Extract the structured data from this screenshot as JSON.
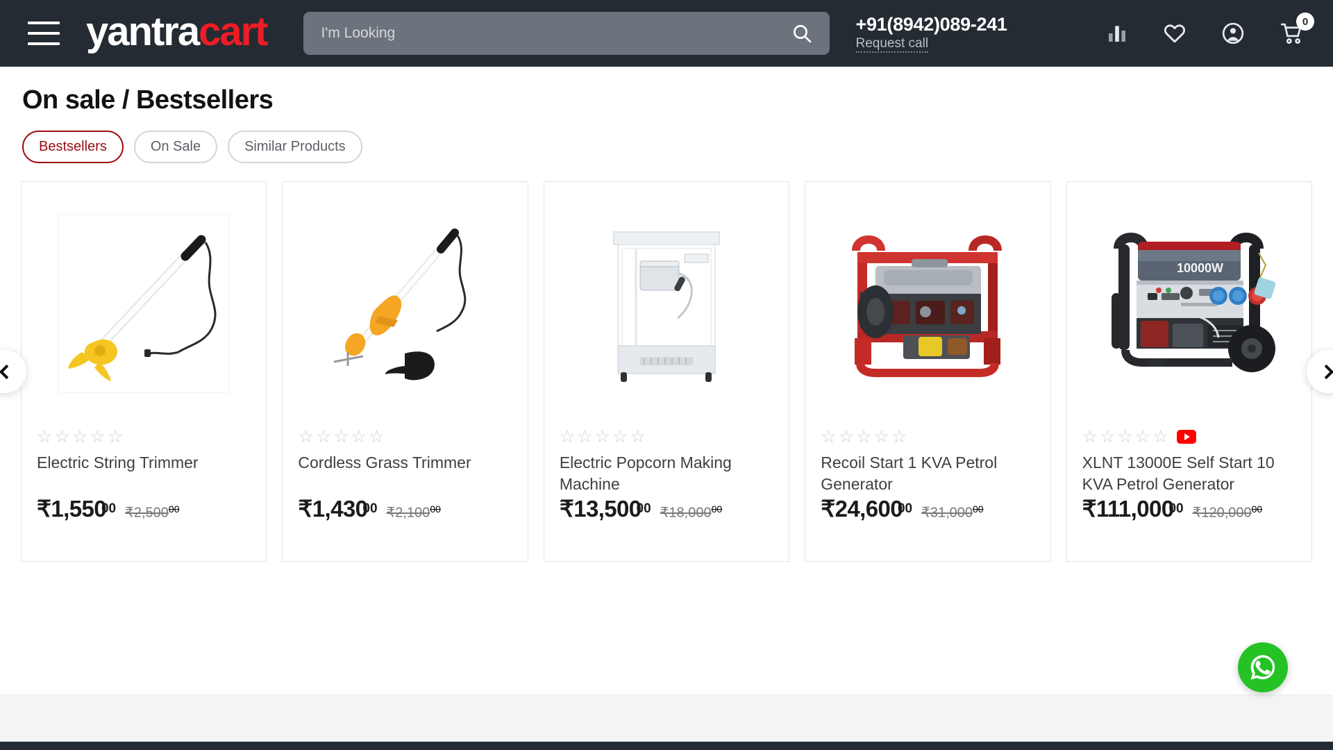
{
  "header": {
    "menu_label": "Menu",
    "logo": {
      "part1": "yantra",
      "part2": "cart",
      "part1_color": "#ffffff",
      "part2_color": "#ee1c25"
    },
    "search": {
      "placeholder": "I'm Looking",
      "value": "",
      "button_label": "Search"
    },
    "phone": "+91(8942)089-241",
    "request_call": "Request call",
    "icons": [
      {
        "name": "compare-icon",
        "label": "Compare"
      },
      {
        "name": "wishlist-icon",
        "label": "Wishlist"
      },
      {
        "name": "account-icon",
        "label": "Account"
      },
      {
        "name": "cart-icon",
        "label": "Cart"
      }
    ],
    "cart_count": "0",
    "background": "#252b33"
  },
  "main": {
    "title": "On sale / Bestsellers",
    "tabs": [
      {
        "label": "Bestsellers",
        "active": true
      },
      {
        "label": "On Sale",
        "active": false
      },
      {
        "label": "Similar Products",
        "active": false
      }
    ],
    "active_tab_color": "#9b0d13"
  },
  "carousel": {
    "prev_label": "Previous",
    "next_label": "Next",
    "rating_empty_star": "☆",
    "products": [
      {
        "name": "Electric String Trimmer",
        "rating": 0,
        "price": "₹1,550",
        "price_cents": "00",
        "old_price": "₹2,500",
        "old_price_cents": "00",
        "has_video": false,
        "image": "electric-string-trimmer"
      },
      {
        "name": "Cordless Grass Trimmer",
        "rating": 0,
        "price": "₹1,430",
        "price_cents": "00",
        "old_price": "₹2,100",
        "old_price_cents": "00",
        "has_video": false,
        "image": "cordless-grass-trimmer"
      },
      {
        "name": "Electric Popcorn Making Machine",
        "rating": 0,
        "price": "₹13,500",
        "price_cents": "00",
        "old_price": "₹18,000",
        "old_price_cents": "00",
        "has_video": false,
        "image": "popcorn-machine"
      },
      {
        "name": "Recoil Start 1 KVA Petrol Generator",
        "rating": 0,
        "price": "₹24,600",
        "price_cents": "00",
        "old_price": "₹31,000",
        "old_price_cents": "00",
        "has_video": false,
        "image": "red-generator"
      },
      {
        "name": "XLNT 13000E Self Start 10 KVA Petrol Generator",
        "rating": 0,
        "price": "₹111,000",
        "price_cents": "00",
        "old_price": "₹120,000",
        "old_price_cents": "00",
        "has_video": true,
        "video_badge": "youtube-icon",
        "image": "blue-generator"
      }
    ]
  },
  "floating": {
    "whatsapp_label": "WhatsApp",
    "whatsapp_color": "#25c225"
  }
}
